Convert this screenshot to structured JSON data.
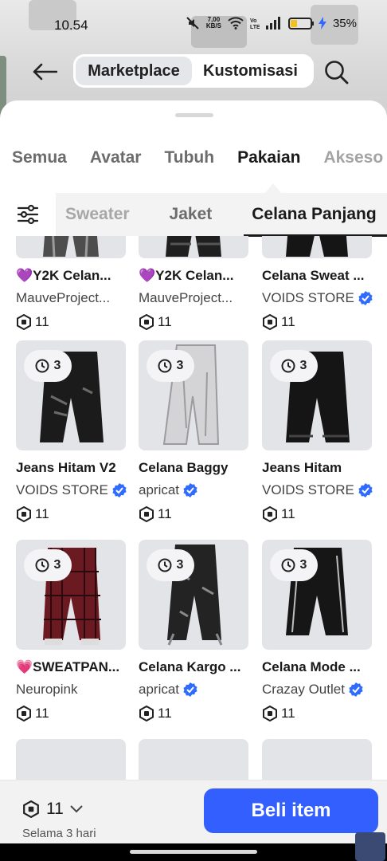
{
  "status": {
    "time": "10.54",
    "speed_top": "7,00",
    "speed_bottom": "KB/S",
    "battery": "35%",
    "battery_level": 0.35
  },
  "header": {
    "tab_marketplace": "Marketplace",
    "tab_kustomisasi": "Kustomisasi"
  },
  "categories": [
    "Semua",
    "Avatar",
    "Tubuh",
    "Pakaian",
    "Akseso"
  ],
  "subcategories": [
    "Sweater",
    "Jaket",
    "Celana Panjang"
  ],
  "items": [
    {
      "name": "💜Y2K Celan...",
      "creator": "MauveProject...",
      "verified": false,
      "price": "11"
    },
    {
      "name": "💜Y2K Celan...",
      "creator": "MauveProject...",
      "verified": false,
      "price": "11"
    },
    {
      "name": "Celana Sweat ...",
      "creator": "VOIDS STORE",
      "verified": true,
      "price": "11"
    },
    {
      "name": "Jeans Hitam V2",
      "creator": "VOIDS STORE",
      "verified": true,
      "price": "11",
      "timer": "3"
    },
    {
      "name": "Celana Baggy",
      "creator": "apricat",
      "verified": true,
      "price": "11",
      "timer": "3"
    },
    {
      "name": "Jeans Hitam",
      "creator": "VOIDS STORE",
      "verified": true,
      "price": "11",
      "timer": "3"
    },
    {
      "name": "💗SWEATPAN...",
      "creator": "Neuropink",
      "verified": false,
      "price": "11",
      "timer": "3"
    },
    {
      "name": "Celana Kargo ...",
      "creator": "apricat",
      "verified": true,
      "price": "11",
      "timer": "3"
    },
    {
      "name": "Celana Mode ...",
      "creator": "Crazay Outlet",
      "verified": true,
      "price": "11",
      "timer": "3"
    }
  ],
  "bottom": {
    "price": "11",
    "duration": "Selama 3 hari",
    "buy_label": "Beli item"
  },
  "colors": {
    "accent": "#335fff",
    "verified": "#2f6bff"
  }
}
